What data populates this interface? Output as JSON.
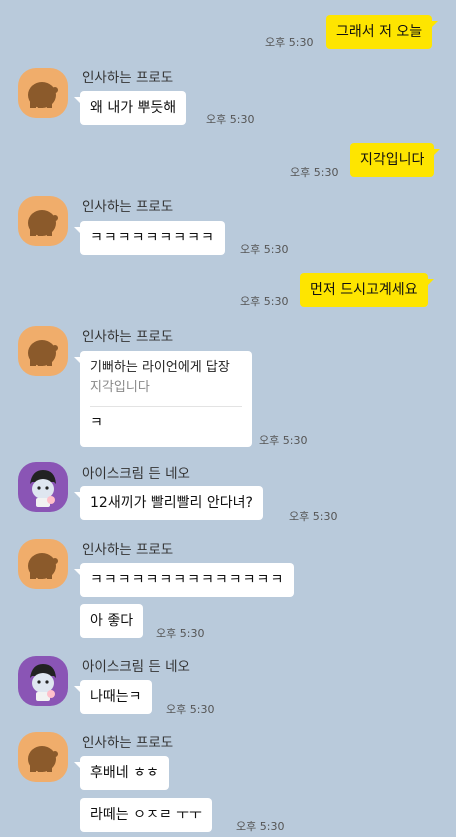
{
  "messages": {
    "m1": {
      "text": "그래서 저 오늘",
      "time": "오후 5:30"
    },
    "g1": {
      "sender": "인사하는 프로도",
      "text": "왜 내가 뿌듯해",
      "time": "오후 5:30"
    },
    "m2": {
      "text": "지각입니다",
      "time": "오후 5:30"
    },
    "g2": {
      "sender": "인사하는 프로도",
      "text": "ㅋㅋㅋㅋㅋㅋㅋㅋㅋ",
      "time": "오후 5:30"
    },
    "m3": {
      "text": "먼저 드시고계세요",
      "time": "오후 5:30"
    },
    "g3": {
      "sender": "인사하는 프로도",
      "reply_title": "기뻐하는 라이언에게 답장",
      "reply_quote": "지각입니다",
      "text": "ㅋ",
      "time": "오후 5:30"
    },
    "g4": {
      "sender": "아이스크림 든 네오",
      "text": "12새끼가 빨리빨리 안다녀?",
      "time": "오후 5:30"
    },
    "g5": {
      "sender": "인사하는 프로도",
      "text1": "ㅋㅋㅋㅋㅋㅋㅋㅋㅋㅋㅋㅋㅋㅋ",
      "text2": "아 좋다",
      "time": "오후 5:30"
    },
    "g6": {
      "sender": "아이스크림 든 네오",
      "text": "나때는ㅋ",
      "time": "오후 5:30"
    },
    "g7": {
      "sender": "인사하는 프로도",
      "text1": "후배네 ㅎㅎ",
      "text2": "라떼는 ㅇㅈㄹ ㅜㅜ",
      "time": "오후 5:30"
    }
  },
  "colors": {
    "background": "#b9cadb",
    "my_bubble": "#fee500",
    "other_bubble": "#ffffff",
    "frodo_avatar": "#f0ad6b",
    "neo_avatar": "#8a55b5"
  },
  "icons": {
    "frodo": "frodo-avatar-icon",
    "neo": "neo-avatar-icon"
  }
}
